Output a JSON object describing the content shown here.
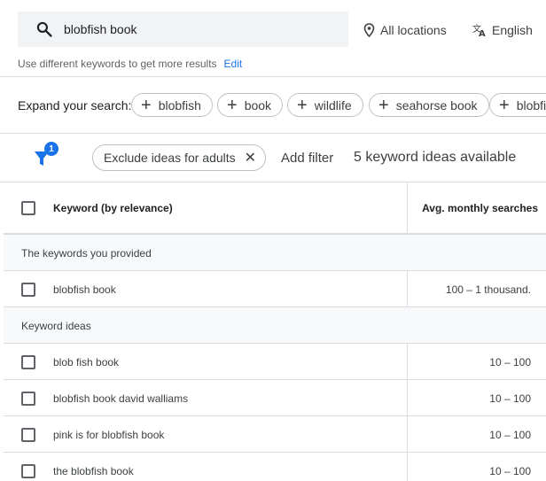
{
  "search": {
    "query": "blobfish book"
  },
  "location": {
    "label": "All locations"
  },
  "language": {
    "label": "English"
  },
  "hint": {
    "text": "Use different keywords to get more results",
    "edit_label": "Edit"
  },
  "expand": {
    "label": "Expand your search:",
    "chips": [
      "blobfish",
      "book",
      "wildlife",
      "seahorse book",
      "blobfi"
    ]
  },
  "filters": {
    "badge_count": "1",
    "chip_label": "Exclude ideas for adults",
    "add_filter_label": "Add filter",
    "ideas_available": "5 keyword ideas available"
  },
  "table": {
    "columns": {
      "keyword": "Keyword (by relevance)",
      "avg": "Avg. monthly searches"
    },
    "groups": [
      {
        "label": "The keywords you provided",
        "rows": [
          {
            "keyword": "blobfish book",
            "avg": "100 – 1 thousand."
          }
        ]
      },
      {
        "label": "Keyword ideas",
        "rows": [
          {
            "keyword": "blob fish book",
            "avg": "10 – 100"
          },
          {
            "keyword": "blobfish book david walliams",
            "avg": "10 – 100"
          },
          {
            "keyword": "pink is for blobfish book",
            "avg": "10 – 100"
          },
          {
            "keyword": "the blobfish book",
            "avg": "10 – 100"
          }
        ]
      }
    ]
  },
  "colors": {
    "accent": "#1a73e8",
    "border": "#dadce0",
    "search_bg": "#f1f3f4"
  }
}
